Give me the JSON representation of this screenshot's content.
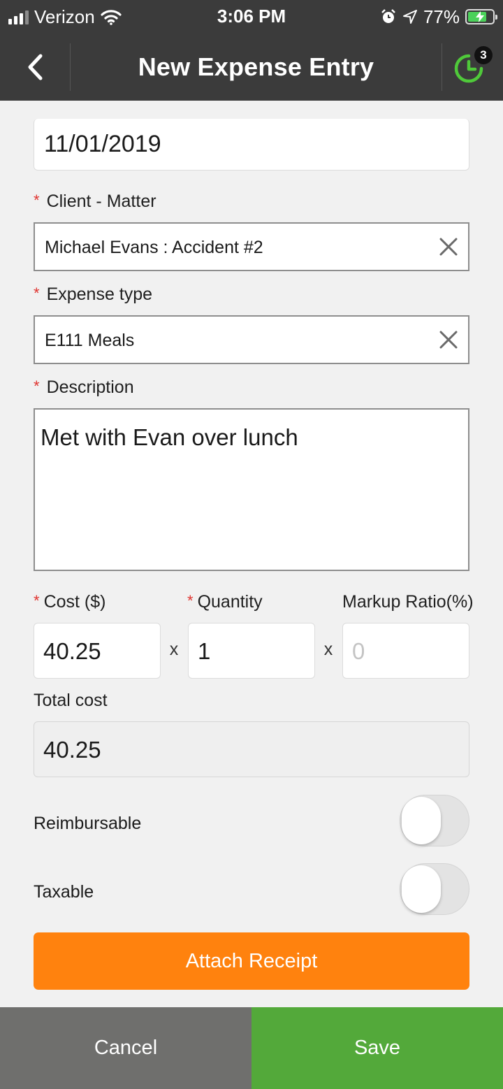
{
  "status_bar": {
    "carrier": "Verizon",
    "time": "3:06 PM",
    "battery": "77%",
    "battery_level": 0.77
  },
  "nav": {
    "title": "New Expense Entry",
    "timer_badge": "3"
  },
  "form": {
    "date": {
      "value": "11/01/2019"
    },
    "client_matter": {
      "label": "Client - Matter",
      "value": "Michael Evans : Accident #2",
      "required": true
    },
    "expense_type": {
      "label": "Expense type",
      "value": "E111 Meals",
      "required": true
    },
    "description": {
      "label": "Description",
      "value": "Met with Evan over lunch",
      "required": true
    },
    "cost": {
      "label": "Cost ($)",
      "value": "40.25",
      "required": true
    },
    "quantity": {
      "label": "Quantity",
      "value": "1",
      "required": true
    },
    "markup": {
      "label": "Markup Ratio(%)",
      "placeholder": "0"
    },
    "multiplier": "x",
    "total_cost": {
      "label": "Total cost",
      "value": "40.25"
    },
    "reimbursable": {
      "label": "Reimbursable",
      "on": false
    },
    "taxable": {
      "label": "Taxable",
      "on": false
    },
    "required_marker": "*"
  },
  "actions": {
    "attach_receipt": "Attach Receipt",
    "cancel": "Cancel",
    "save": "Save"
  },
  "colors": {
    "header_bg": "#3b3b3b",
    "accent_orange": "#ff820e",
    "save_green": "#53a93a",
    "cancel_gray": "#6f6f6d",
    "required_red": "#e0332f",
    "timer_green": "#4fc93a"
  },
  "icons": {
    "back": "chevron-left-icon",
    "timer": "timer-clock-icon",
    "clear": "close-icon",
    "wifi": "wifi-icon",
    "alarm": "alarm-icon",
    "location": "location-arrow-icon"
  }
}
